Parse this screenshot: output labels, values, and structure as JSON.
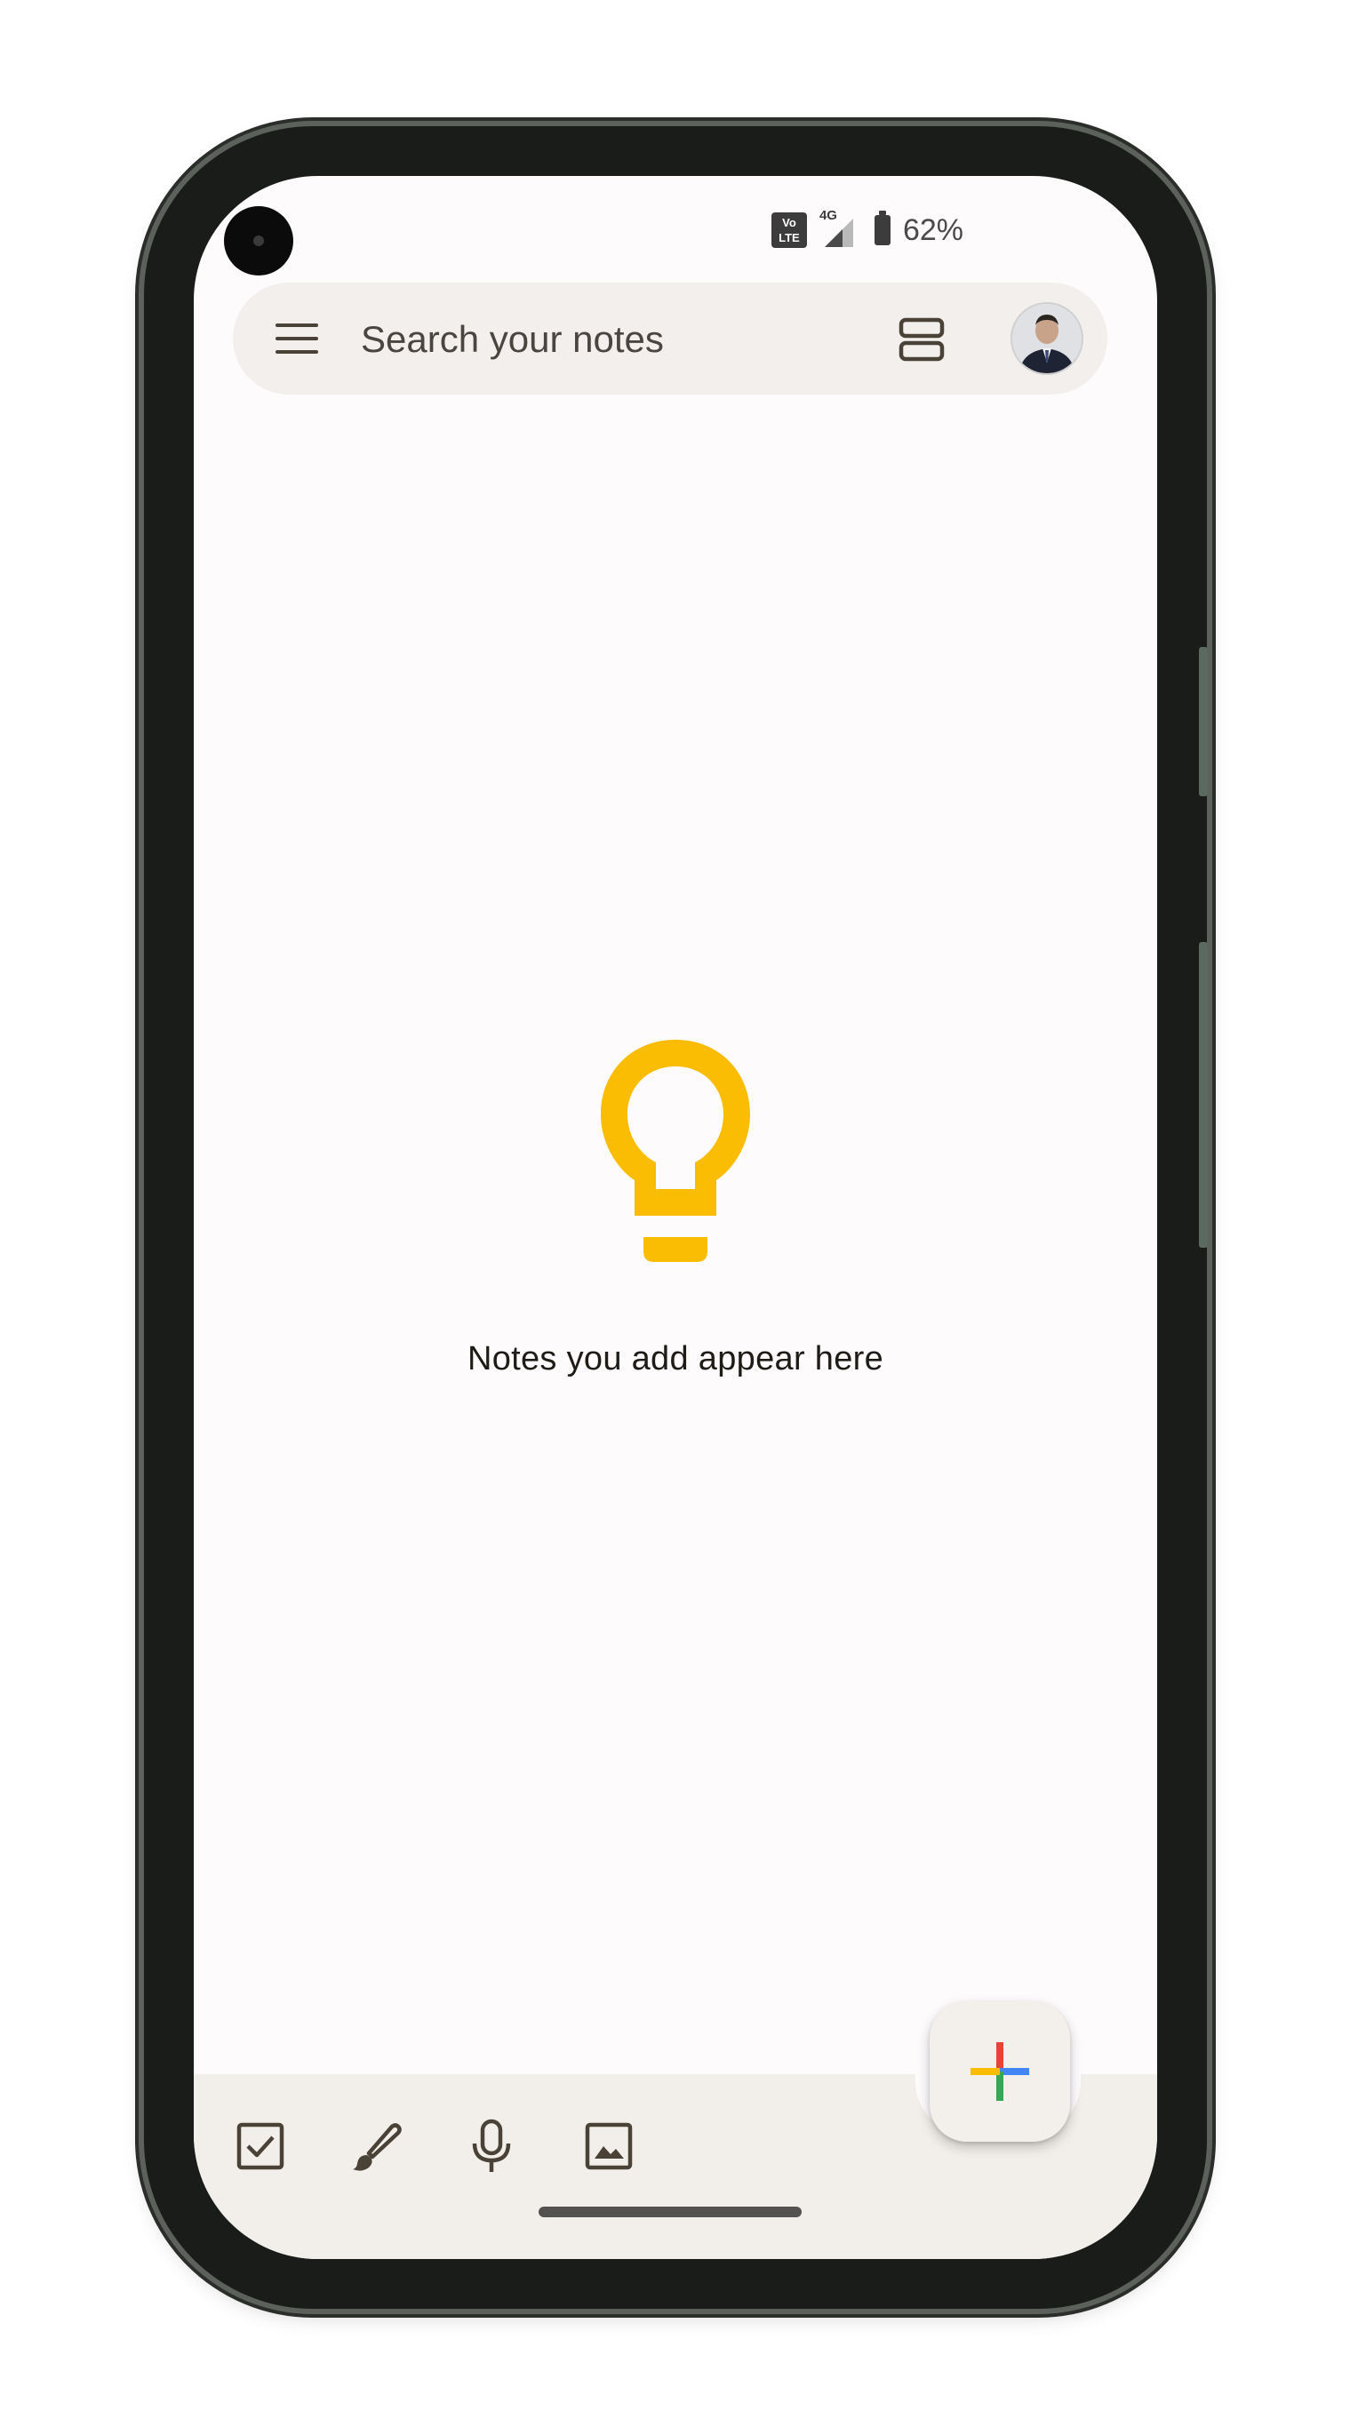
{
  "status_bar": {
    "volte_top": "Vo",
    "volte_bottom": "LTE",
    "network": "4G",
    "battery_percent": "62%",
    "battery_icon": "battery-icon",
    "signal_icon": "signal-icon"
  },
  "search_bar": {
    "placeholder": "Search your notes",
    "menu_icon": "hamburger-menu-icon",
    "view_toggle_icon": "list-view-icon",
    "avatar": "account-avatar"
  },
  "empty_state": {
    "icon": "lightbulb-icon",
    "icon_color": "#FBBC04",
    "message": "Notes you add appear here"
  },
  "bottom_toolbar": {
    "items": [
      {
        "icon": "checkbox-icon"
      },
      {
        "icon": "brush-icon"
      },
      {
        "icon": "microphone-icon"
      },
      {
        "icon": "image-icon"
      }
    ],
    "fab_icon": "google-plus-icon",
    "fab_colors": [
      "#EA4335",
      "#4285F4",
      "#34A853",
      "#FBBC04"
    ]
  },
  "colors": {
    "screen_bg": "#FEFBFD",
    "bar_bg": "#F2EFEC",
    "icon_color": "#4B4237",
    "text_color": "#1F1B16"
  }
}
